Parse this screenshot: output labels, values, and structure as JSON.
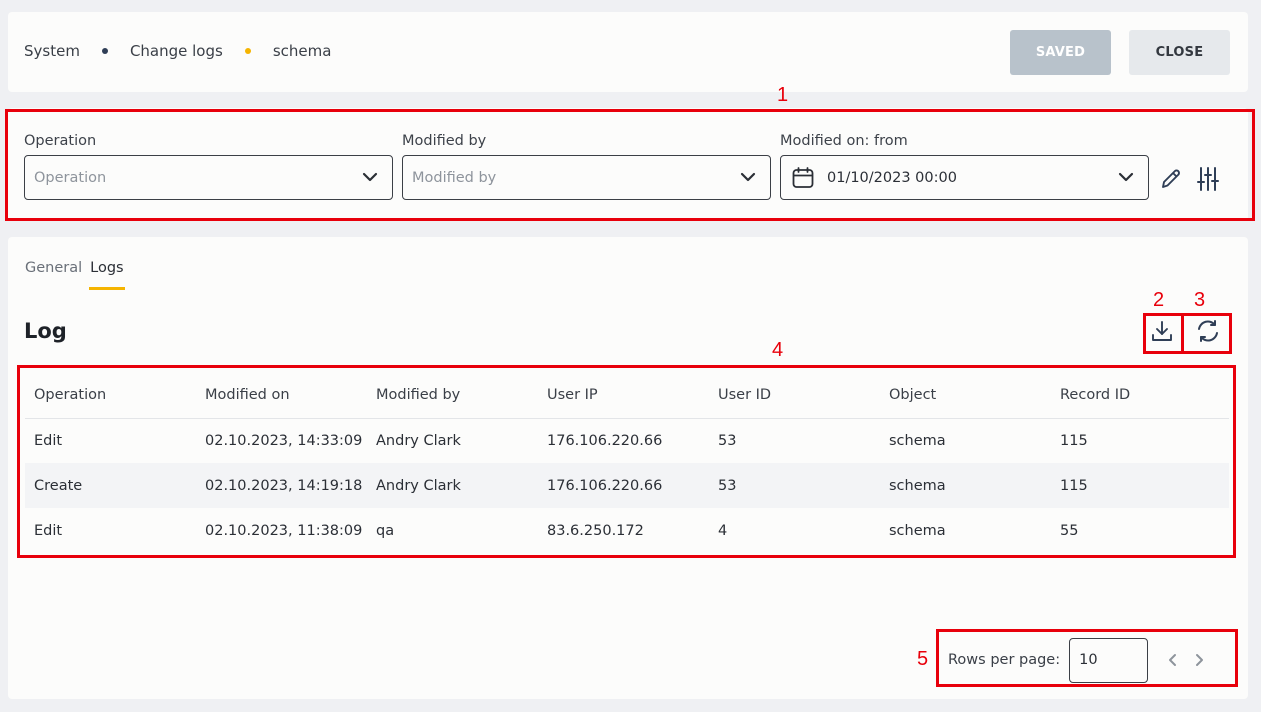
{
  "breadcrumb": {
    "items": [
      "System",
      "Change logs",
      "schema"
    ],
    "dot_colors": [
      "#2f3e56",
      "#f5b400"
    ]
  },
  "header_buttons": {
    "saved": "SAVED",
    "close": "CLOSE"
  },
  "filters": {
    "operation": {
      "label": "Operation",
      "placeholder": "Operation"
    },
    "modified_by": {
      "label": "Modified by",
      "placeholder": "Modified by"
    },
    "modified_on": {
      "label": "Modified on: from",
      "value": "01/10/2023 00:00"
    },
    "icons": [
      "pencil-icon",
      "sliders-icon"
    ]
  },
  "tabs": [
    {
      "label": "General",
      "active": false
    },
    {
      "label": "Logs",
      "active": true
    }
  ],
  "log": {
    "title": "Log",
    "icons": [
      "download-icon",
      "refresh-icon"
    ],
    "columns": [
      "Operation",
      "Modified on",
      "Modified by",
      "User IP",
      "User ID",
      "Object",
      "Record ID"
    ],
    "rows": [
      [
        "Edit",
        "02.10.2023, 14:33:09",
        "Andry Clark",
        "176.106.220.66",
        "53",
        "schema",
        "115"
      ],
      [
        "Create",
        "02.10.2023, 14:19:18",
        "Andry Clark",
        "176.106.220.66",
        "53",
        "schema",
        "115"
      ],
      [
        "Edit",
        "02.10.2023, 11:38:09",
        "qa",
        "83.6.250.172",
        "4",
        "schema",
        "55"
      ]
    ]
  },
  "pagination": {
    "rows_per_page_label": "Rows per page:",
    "rows_per_page_value": "10"
  },
  "annotations": [
    "1",
    "2",
    "3",
    "4",
    "5"
  ],
  "colors": {
    "accent": "#f5b400",
    "annotation": "#e8000b",
    "saved_button": "#b8c2cb"
  }
}
